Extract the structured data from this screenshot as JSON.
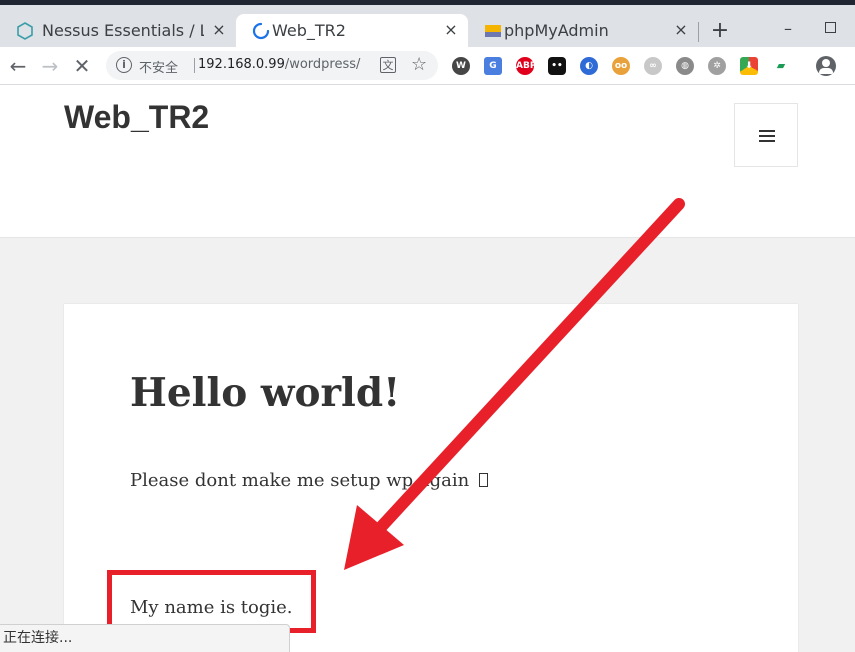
{
  "browser": {
    "tabs": [
      {
        "title": "Nessus Essentials / Lo",
        "icon": "nessus-icon",
        "close": "×"
      },
      {
        "title": "Web_TR2",
        "icon": "loading-spinner-icon",
        "close": "×"
      },
      {
        "title": "phpMyAdmin",
        "icon": "phpmyadmin-icon",
        "close": "×"
      }
    ],
    "new_tab": "+",
    "minimize": "–",
    "address": {
      "security_label": "不安全",
      "host": "192.168.0.99",
      "path": "/wordpress/"
    },
    "status_text": "正在连接..."
  },
  "site": {
    "title": "Web_TR2"
  },
  "post": {
    "title": "Hello world!",
    "paragraph1": "Please dont make me setup wp again",
    "paragraph2": "My name is togie."
  },
  "colors": {
    "annotation_red": "#e8202a",
    "tabbar_bg": "#dee1e6",
    "page_bg": "#f1f1f1"
  }
}
